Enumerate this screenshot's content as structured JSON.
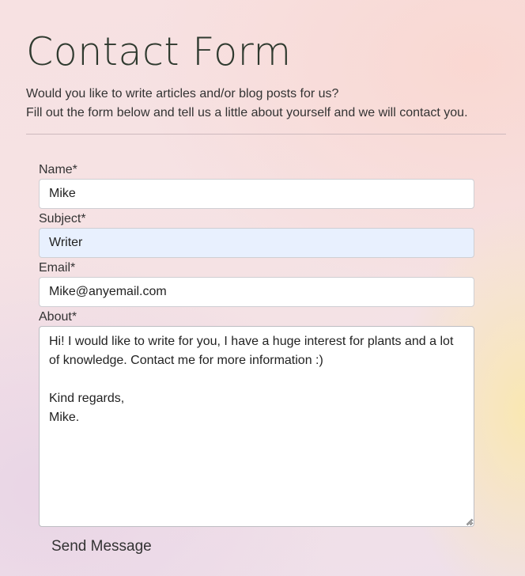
{
  "page": {
    "title": "Contact Form",
    "intro_line_1": "Would you like to write articles and/or blog posts for us?",
    "intro_line_2": "Fill out the form below and tell us a little about yourself and we will contact you."
  },
  "form": {
    "name": {
      "label": "Name*",
      "value": "Mike"
    },
    "subject": {
      "label": "Subject*",
      "value": "Writer",
      "autofilled": true
    },
    "email": {
      "label": "Email*",
      "value": "Mike@anyemail.com"
    },
    "about": {
      "label": "About*",
      "value": "Hi! I would like to write for you, I have a huge interest for plants and a lot of knowledge. Contact me for more information :)\n\nKind regards,\nMike."
    },
    "submit_label": "Send Message"
  },
  "colors": {
    "autofill_background": "#e8f0fe",
    "title_color": "#2f3a2f"
  }
}
